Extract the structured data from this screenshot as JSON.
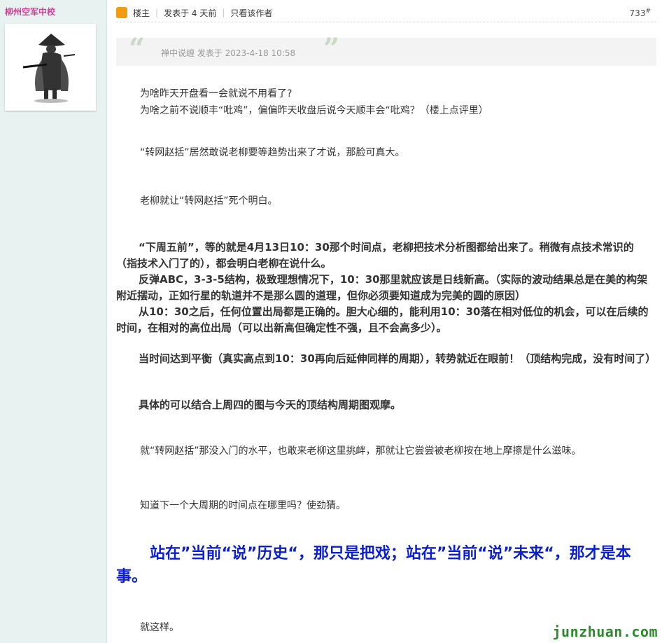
{
  "user": {
    "name": "柳州空军中校"
  },
  "post": {
    "role": "楼主",
    "posted": "发表于 4 天前",
    "author_only": "只看该作者",
    "floor_number": "733",
    "floor_mark": "#"
  },
  "quote": {
    "open": "“",
    "close": "”",
    "meta": "禅中说缠 发表于 2023-4-18 10:58"
  },
  "content": {
    "l1": "为啥昨天开盘看一会就说不用看了?",
    "l2": "为啥之前不说顺丰“吡鸡”，偏偏昨天收盘后说今天顺丰会“吡鸡？（楼上点评里）",
    "l3": "“转网赵括”居然敢说老柳要等趋势出来了才说，那脸可真大。",
    "l4": "老柳就让“转网赵括”死个明白。",
    "b1": "“下周五前”，等的就是4月13日10：30那个时间点，老柳把技术分析图都给出来了。稍微有点技术常识的（指技术入门了的），都会明白老柳在说什么。",
    "b2": "反弹ABC，3-3-5结构，极致理想情况下，10：30那里就应该是日线新高。（实际的波动结果总是在美的构架附近摆动，正如行星的轨道并不是那么圆的道理，但你必须要知道成为完美的圆的原因）",
    "b3": "从10：30之后，任何位置出局都是正确的。胆大心细的，能利用10：30落在相对低位的机会，可以在后续的时间，在相对的高位出局（可以出新高但确定性不强，且不会高多少）。",
    "b4": "当时间达到平衡（真实高点到10：30再向后延伸同样的周期），转势就近在眼前！（顶结构完成，没有时间了）",
    "b5": "具体的可以结合上周四的图与今天的顶结构周期图观摩。",
    "l5": "就“转网赵括”那没入门的水平，也敢来老柳这里挑衅，那就让它尝尝被老柳按在地上摩擦是什么滋味。",
    "l6": "知道下一个大周期的时间点在哪里吗？使劲猜。",
    "big": "站在”当前“说”历史“，那只是把戏；站在”当前“说”未来“，那才是本事。",
    "end": "就这样。"
  },
  "watermark": "junzhuan.com",
  "colors": {
    "username": "#e0399a",
    "emphasis": "#0b1fd1",
    "sidebar": "#e8f3f1",
    "watermark": "#2f8a2f"
  }
}
